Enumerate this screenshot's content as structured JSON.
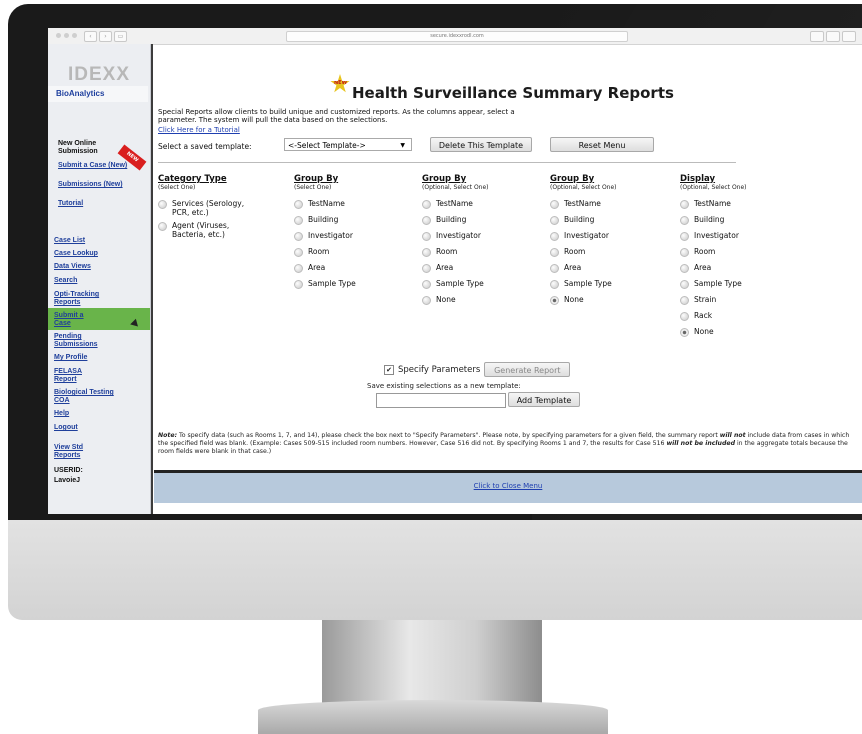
{
  "browser": {
    "url": "secure.idexxrodl.com"
  },
  "sidebar": {
    "logo": "IDEXX",
    "subbrand": "BioAnalytics",
    "new_online_submission": "New Online Submission",
    "new_badge": "NEW",
    "submit_case_new": "Submit a Case (New)",
    "submissions_new": "Submissions (New)",
    "tutorial": "Tutorial",
    "links": [
      "Case List",
      "Case Lookup",
      "Data Views",
      "Search",
      "Opti-Tracking Reports",
      "Submit a Case",
      "Pending Submissions",
      "My Profile",
      "FELASA Report",
      "Biological Testing COA",
      "Help",
      "Logout",
      "View Std Reports"
    ],
    "userid_label": "USERID:",
    "userid_value": "LavoieJ",
    "active_item": "Opti-Tracking Reports"
  },
  "main": {
    "badge_text": "NEW",
    "title": "Health Surveillance Summary Reports",
    "intro": "Special Reports allow clients to build unique and customized reports. As the columns appear, select a parameter. The system will pull the data based on the selections.",
    "tutorial_link": "Click Here for a Tutorial",
    "template_label": "Select a saved template:",
    "template_select": "<-Select Template->",
    "delete_button": "Delete This Template",
    "reset_button": "Reset Menu",
    "columns": [
      {
        "heading": "Category Type",
        "sub": "(Select One)",
        "options": [
          "Services (Serology, PCR, etc.)",
          "Agent (Viruses, Bacteria, etc.)"
        ],
        "selected": null
      },
      {
        "heading": "Group By",
        "sub": "(Select One)",
        "options": [
          "TestName",
          "Building",
          "Investigator",
          "Room",
          "Area",
          "Sample Type"
        ],
        "selected": null
      },
      {
        "heading": "Group By",
        "sub": "(Optional, Select One)",
        "options": [
          "TestName",
          "Building",
          "Investigator",
          "Room",
          "Area",
          "Sample Type",
          "None"
        ],
        "selected": null
      },
      {
        "heading": "Group By",
        "sub": "(Optional, Select One)",
        "options": [
          "TestName",
          "Building",
          "Investigator",
          "Room",
          "Area",
          "Sample Type",
          "None"
        ],
        "selected": "None"
      },
      {
        "heading": "Display",
        "sub": "(Optional, Select One)",
        "options": [
          "TestName",
          "Building",
          "Investigator",
          "Room",
          "Area",
          "Sample Type",
          "Strain",
          "Rack",
          "None"
        ],
        "selected": "None"
      }
    ],
    "specify_parameters": "Specify Parameters",
    "specify_checked": true,
    "generate_button": "Generate Report",
    "save_text": "Save existing selections as a new template:",
    "add_template_button": "Add Template",
    "note_label": "Note:",
    "note_text_1": " To specify data (such as Rooms 1, 7, and 14), please check the box next to \"Specify Parameters\". Please note, by specifying parameters for a given field, the summary report ",
    "note_bold_1": "will not",
    "note_text_2": " include data from cases in which the specified field was blank. (Example: Cases 509-515 included room numbers. However, Case 516 did not. By specifying Rooms 1 and 7, the results for Case 516 ",
    "note_bold_2": "will not be included",
    "note_text_3": " in the aggregate totals because the room fields were blank in that case.)",
    "close_menu": "Click to Close Menu"
  }
}
